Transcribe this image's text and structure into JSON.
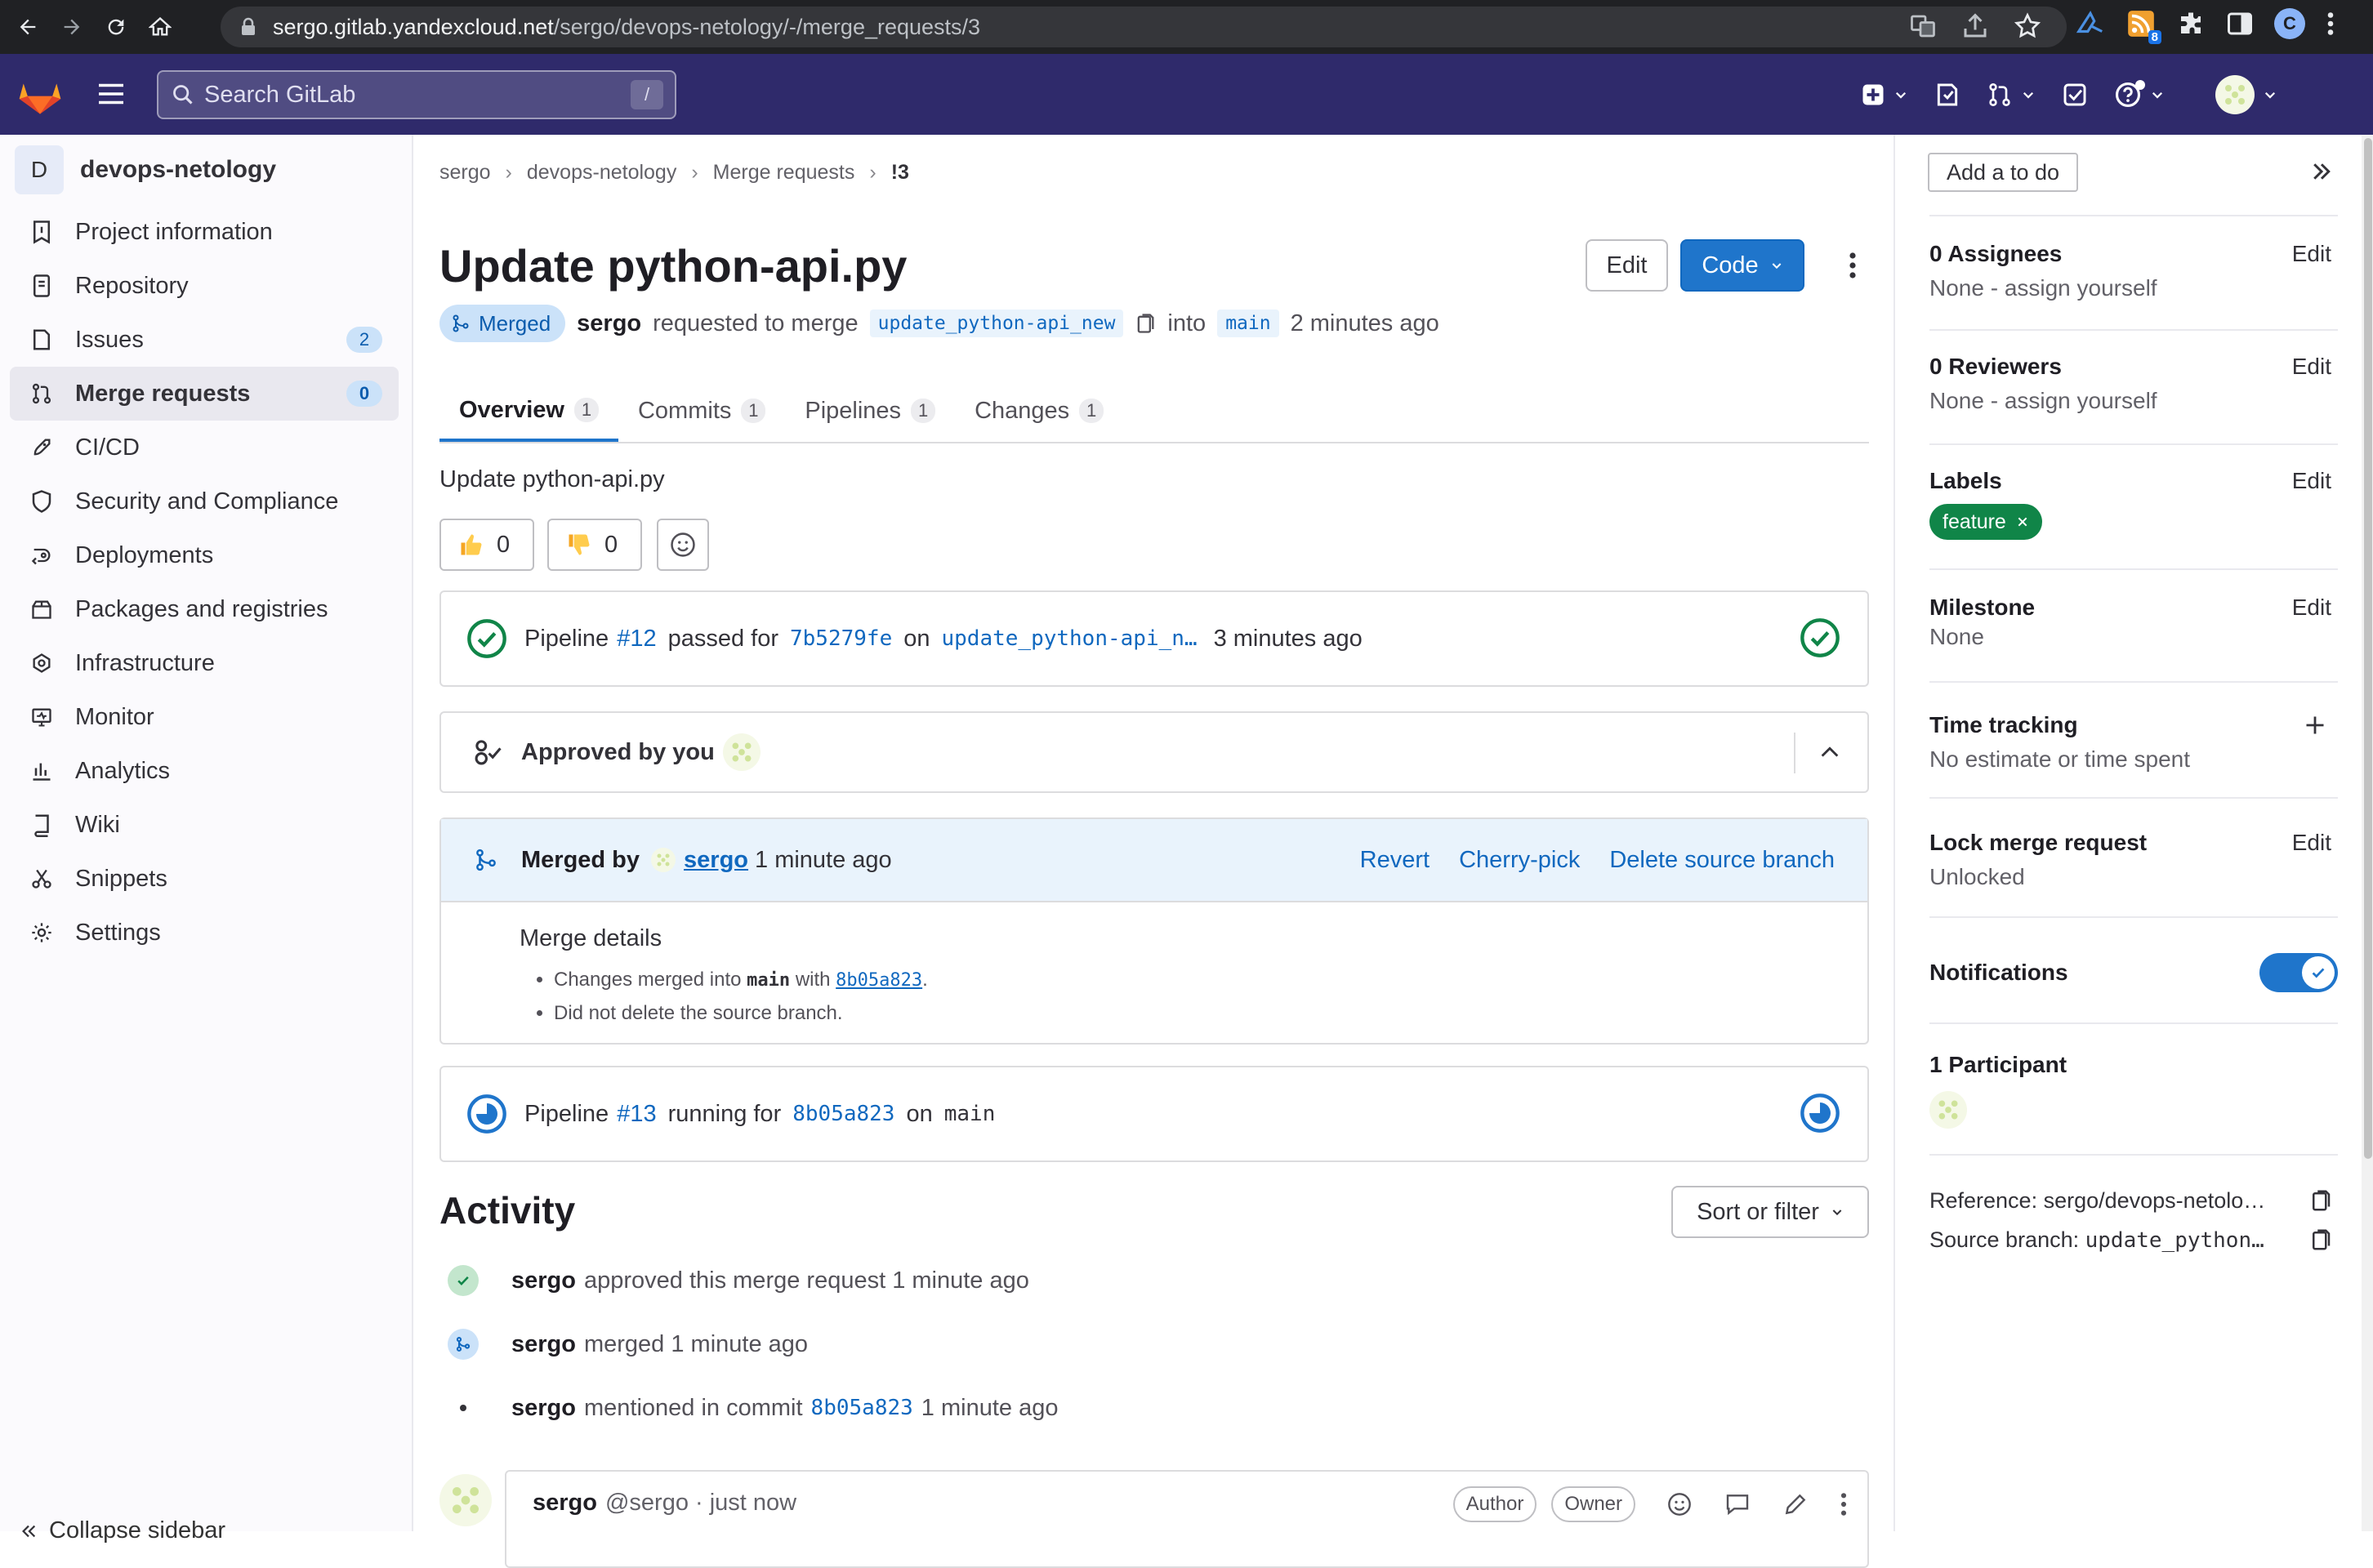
{
  "browser": {
    "url_host": "sergo.gitlab.yandexcloud.net",
    "url_path": "/sergo/devops-netology/-/merge_requests/3",
    "profile_letter": "C",
    "ext_badge": "8"
  },
  "topbar": {
    "search_placeholder": "Search GitLab",
    "search_shortcut": "/"
  },
  "sidebar": {
    "project_initial": "D",
    "project_name": "devops-netology",
    "items": [
      {
        "label": "Project information",
        "icon": "info-icon"
      },
      {
        "label": "Repository",
        "icon": "repository-icon"
      },
      {
        "label": "Issues",
        "icon": "issues-icon",
        "badge": "2"
      },
      {
        "label": "Merge requests",
        "icon": "merge-request-icon",
        "badge": "0"
      },
      {
        "label": "CI/CD",
        "icon": "rocket-icon"
      },
      {
        "label": "Security and Compliance",
        "icon": "shield-icon"
      },
      {
        "label": "Deployments",
        "icon": "deployments-icon"
      },
      {
        "label": "Packages and registries",
        "icon": "package-icon"
      },
      {
        "label": "Infrastructure",
        "icon": "cloud-icon"
      },
      {
        "label": "Monitor",
        "icon": "monitor-icon"
      },
      {
        "label": "Analytics",
        "icon": "chart-icon"
      },
      {
        "label": "Wiki",
        "icon": "book-icon"
      },
      {
        "label": "Snippets",
        "icon": "scissors-icon"
      },
      {
        "label": "Settings",
        "icon": "gear-icon"
      }
    ],
    "collapse_label": "Collapse sidebar"
  },
  "breadcrumb": [
    "sergo",
    "devops-netology",
    "Merge requests",
    "!3"
  ],
  "mr": {
    "title": "Update python-api.py",
    "edit_label": "Edit",
    "code_label": "Code",
    "status": "Merged",
    "author": "sergo",
    "requested_text": "requested to merge",
    "source_branch": "update_python-api_new",
    "into_text": "into",
    "target_branch": "main",
    "time_text": "2 minutes ago",
    "tabs": [
      {
        "label": "Overview",
        "count": "1"
      },
      {
        "label": "Commits",
        "count": "1"
      },
      {
        "label": "Pipelines",
        "count": "1"
      },
      {
        "label": "Changes",
        "count": "1"
      }
    ],
    "description": "Update python-api.py",
    "thumbs_up": "0",
    "thumbs_down": "0"
  },
  "pipeline12": {
    "prefix": "Pipeline",
    "id": "#12",
    "status_text": "passed for",
    "commit": "7b5279fe",
    "on_text": "on",
    "branch": "update_python-api_n…",
    "time": "3 minutes ago"
  },
  "approval": {
    "text": "Approved by you"
  },
  "merged": {
    "prefix": "Merged by",
    "user": "sergo",
    "time": "1 minute ago",
    "revert": "Revert",
    "cherry_pick": "Cherry-pick",
    "delete_branch": "Delete source branch",
    "details_title": "Merge details",
    "detail1_prefix": "Changes merged into",
    "detail1_branch": "main",
    "detail1_with": "with",
    "detail1_commit": "8b05a823",
    "detail1_suffix": ".",
    "detail2": "Did not delete the source branch."
  },
  "pipeline13": {
    "prefix": "Pipeline",
    "id": "#13",
    "status_text": "running for",
    "commit": "8b05a823",
    "on_text": "on",
    "branch": "main"
  },
  "activity": {
    "title": "Activity",
    "sort_label": "Sort or filter",
    "events": [
      {
        "user": "sergo",
        "text": "approved this merge request 1 minute ago"
      },
      {
        "user": "sergo",
        "text": "merged 1 minute ago"
      },
      {
        "user": "sergo",
        "text_before": "mentioned in commit",
        "commit": "8b05a823",
        "text_after": "1 minute ago"
      }
    ],
    "comment": {
      "user": "sergo",
      "handle": "@sergo · just now",
      "author_badge": "Author",
      "owner_badge": "Owner"
    }
  },
  "right": {
    "todo_label": "Add a to do",
    "assignees_title": "0 Assignees",
    "assignees_value": "None - assign yourself",
    "reviewers_title": "0 Reviewers",
    "reviewers_value": "None - assign yourself",
    "labels_title": "Labels",
    "label_name": "feature",
    "milestone_title": "Milestone",
    "milestone_value": "None",
    "time_title": "Time tracking",
    "time_value": "No estimate or time spent",
    "lock_title": "Lock merge request",
    "lock_value": "Unlocked",
    "notifications_title": "Notifications",
    "participants_title": "1 Participant",
    "reference": "Reference: sergo/devops-netolo…",
    "source_branch_prefix": "Source branch:",
    "source_branch_value": "update_python…",
    "edit_label": "Edit"
  },
  "colors": {
    "topbar": "#2f2a6b",
    "accent": "#1f75cb",
    "success": "#108548",
    "merged_bg": "#e9f3fc"
  }
}
